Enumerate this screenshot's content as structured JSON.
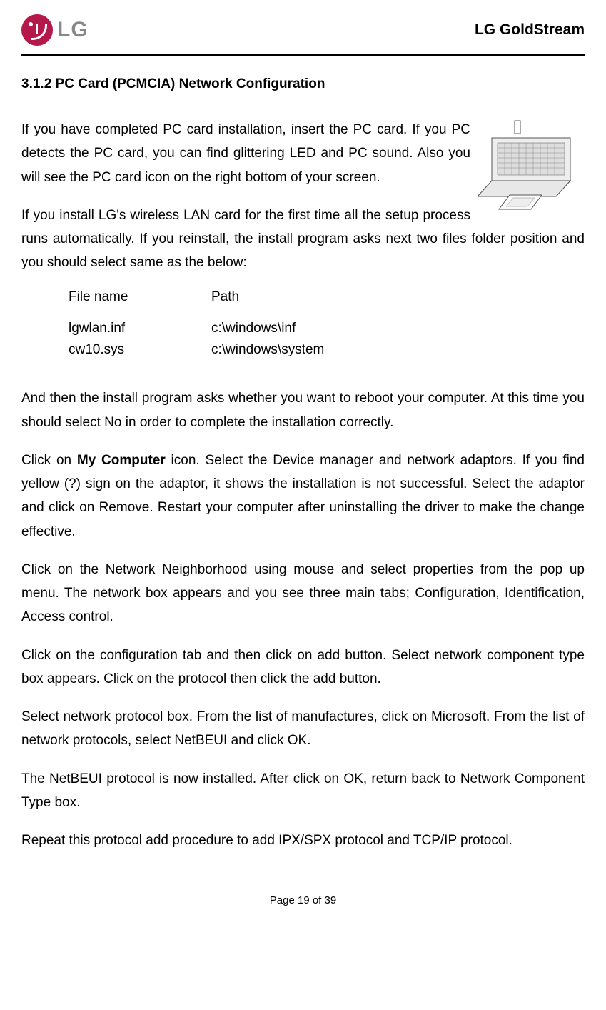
{
  "header": {
    "brand": "LG",
    "product": "LG GoldStream"
  },
  "section_title": "3.1.2 PC Card (PCMCIA) Network Configuration",
  "para1": "If you have completed PC card installation, insert the PC card. If you PC detects the PC card, you can find glittering LED and PC sound. Also you will see the PC card icon on the right bottom of your screen.",
  "para2": "If you install LG's wireless LAN card for the first time all the setup process runs automatically. If you reinstall, the install program asks next two files folder position and you should select same as the below:",
  "table": {
    "headers": {
      "file": "File name",
      "path": "Path"
    },
    "rows": [
      {
        "file": "lgwlan.inf",
        "path": "c:\\windows\\inf"
      },
      {
        "file": "cw10.sys",
        "path": "c:\\windows\\system"
      }
    ]
  },
  "para3": "And then the install program asks whether you want to reboot your computer. At this time you should select No in order to complete the installation correctly.",
  "para4_pre": "Click on ",
  "para4_bold": "My Computer",
  "para4_post": " icon. Select the Device manager and network adaptors. If you find yellow (?) sign on the adaptor, it shows the installation is not successful. Select the adaptor and click on Remove. Restart your computer after uninstalling the driver to make the change effective.",
  "para5": "Click on the Network Neighborhood using mouse and select properties from the pop up menu. The network box appears and you see three main tabs; Configuration, Identification, Access control.",
  "para6": "Click on the configuration tab and then click on add button. Select network component type box appears. Click on the protocol then click the add button.",
  "para7": "Select network protocol box. From the list of manufactures, click on Microsoft. From the list of network protocols, select NetBEUI and click OK.",
  "para8": "The NetBEUI protocol is now installed. After  click on OK, return back to Network Component Type box.",
  "para9": "Repeat this protocol add procedure to add IPX/SPX protocol and TCP/IP protocol.",
  "footer": "Page 19 of 39"
}
